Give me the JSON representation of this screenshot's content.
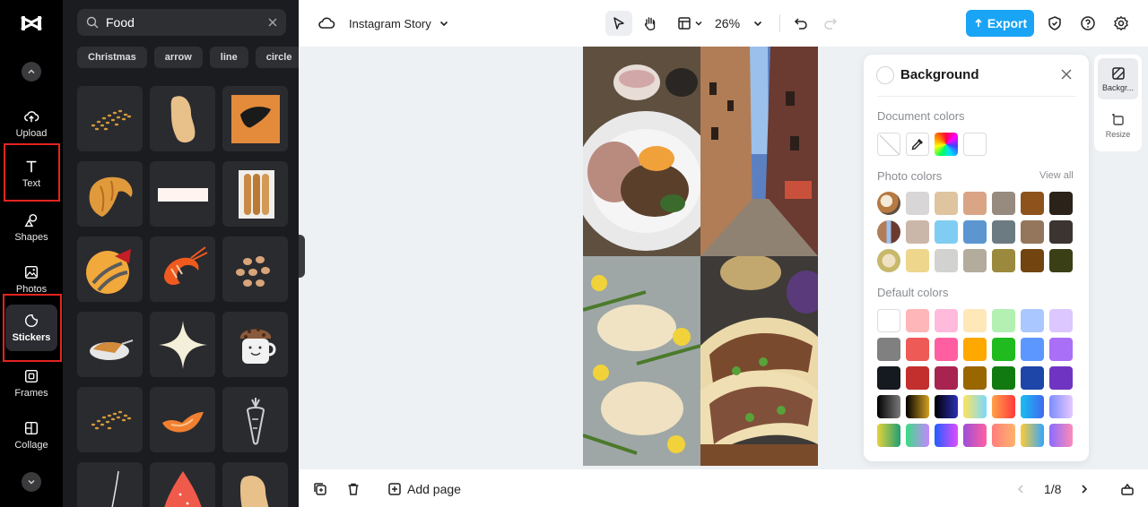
{
  "rail": {
    "items": [
      {
        "label": "Upload"
      },
      {
        "label": "Text"
      },
      {
        "label": "Shapes"
      },
      {
        "label": "Photos"
      },
      {
        "label": "Stickers"
      },
      {
        "label": "Frames"
      },
      {
        "label": "Collage"
      }
    ],
    "active_index": 4
  },
  "panel": {
    "search_value": "Food",
    "chips": [
      "Christmas",
      "arrow",
      "line",
      "circle"
    ]
  },
  "topbar": {
    "project_title": "Instagram Story",
    "zoom": "26%",
    "export_label": "Export"
  },
  "bottombar": {
    "add_page_label": "Add page",
    "page_indicator": "1/8"
  },
  "background_panel": {
    "title": "Background",
    "document_colors_label": "Document colors",
    "photo_colors_label": "Photo colors",
    "view_all_label": "View all",
    "default_colors_label": "Default colors",
    "document_colors": [
      "none",
      "eyedropper",
      "spectrum",
      "#ffffff"
    ],
    "photo_colors": [
      [
        "#d8d6d6",
        "#dfc4a0",
        "#d9a585",
        "#978a7e",
        "#8e531d",
        "#2b2319"
      ],
      [
        "#cbb7a9",
        "#7fcdf2",
        "#5b96d0",
        "#6c7b82",
        "#93765c",
        "#3c3430"
      ],
      [
        "#eed78c",
        "#d2d2d0",
        "#b3ab9c",
        "#9b8a3d",
        "#72440f",
        "#3b3f16"
      ]
    ],
    "default_colors": [
      [
        "#ffffff",
        "#ffb6b8",
        "#ffbadc",
        "#ffe8b8",
        "#b3f0b1",
        "#abc7ff",
        "#dcc7ff"
      ],
      [
        "#808080",
        "#ee5a55",
        "#ff5fa0",
        "#ffa800",
        "#1fbb1f",
        "#5c97ff",
        "#a96ff6"
      ],
      [
        "#151a20",
        "#c22f2d",
        "#a82350",
        "#9a6600",
        "#117b11",
        "#1e45a8",
        "#6f35c2"
      ]
    ],
    "gradient_colors": [
      [
        "#000000",
        "#7a7a7a",
        "#000000",
        "#d4a021",
        "#000000",
        "#2d2fb8",
        "#ffe35c",
        "#7ad9ff",
        "#ffa14a",
        "#ff3b3b",
        "#16c0f0",
        "#4268f0",
        "#7c8dff",
        "#e7c7ff"
      ],
      [
        "#e6d23a",
        "#1f9f74",
        "#3ddc84",
        "#c387ff",
        "#2060ff",
        "#e24bff",
        "#9d4ed8",
        "#ff5fa2",
        "#ff7e7e",
        "#ffb36b",
        "#ffcc33",
        "#33a6ff",
        "#8a6cff",
        "#ff8ab8"
      ]
    ]
  },
  "right_rail": {
    "items": [
      {
        "label": "Backgr..."
      },
      {
        "label": "Resize"
      }
    ]
  }
}
